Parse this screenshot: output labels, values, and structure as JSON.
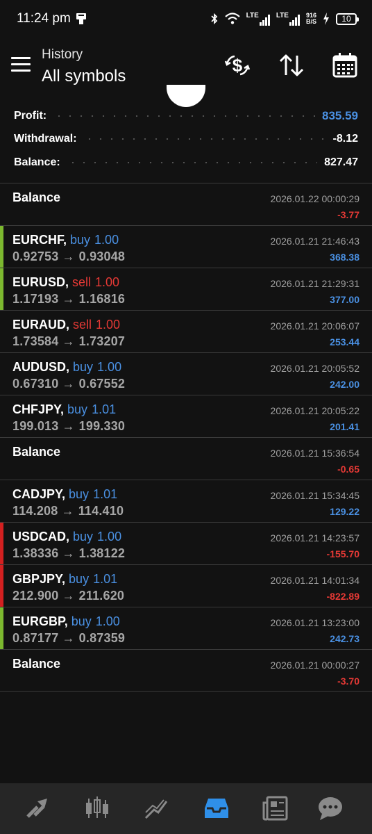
{
  "status": {
    "time": "11:24 pm",
    "lte1": "LTE",
    "lte2": "LTE",
    "speed_top": "916",
    "speed_bottom": "B/S",
    "battery": "10"
  },
  "header": {
    "title": "History",
    "subtitle": "All symbols",
    "icons": [
      "currency-exchange-icon",
      "sort-icon",
      "calendar-icon"
    ]
  },
  "summary": {
    "profit_label": "Profit:",
    "profit_value": "835.59",
    "withdrawal_label": "Withdrawal:",
    "withdrawal_value": "-8.12",
    "balance_label": "Balance:",
    "balance_value": "827.47"
  },
  "history": [
    {
      "symbol": "Balance",
      "side": "",
      "volume": "",
      "open": "",
      "close": "",
      "time": "2026.01.22 00:00:29",
      "profit": "-3.77",
      "kind": "balance",
      "pnl": "neg"
    },
    {
      "symbol": "EURCHF,",
      "side": "buy",
      "volume": "1.00",
      "open": "0.92753",
      "close": "0.93048",
      "time": "2026.01.21 21:46:43",
      "profit": "368.38",
      "kind": "win",
      "pnl": "pos"
    },
    {
      "symbol": "EURUSD,",
      "side": "sell",
      "volume": "1.00",
      "open": "1.17193",
      "close": "1.16816",
      "time": "2026.01.21 21:29:31",
      "profit": "377.00",
      "kind": "win",
      "pnl": "pos"
    },
    {
      "symbol": "EURAUD,",
      "side": "sell",
      "volume": "1.00",
      "open": "1.73584",
      "close": "1.73207",
      "time": "2026.01.21 20:06:07",
      "profit": "253.44",
      "kind": "none",
      "pnl": "pos"
    },
    {
      "symbol": "AUDUSD,",
      "side": "buy",
      "volume": "1.00",
      "open": "0.67310",
      "close": "0.67552",
      "time": "2026.01.21 20:05:52",
      "profit": "242.00",
      "kind": "none",
      "pnl": "pos"
    },
    {
      "symbol": "CHFJPY,",
      "side": "buy",
      "volume": "1.01",
      "open": "199.013",
      "close": "199.330",
      "time": "2026.01.21 20:05:22",
      "profit": "201.41",
      "kind": "none",
      "pnl": "pos"
    },
    {
      "symbol": "Balance",
      "side": "",
      "volume": "",
      "open": "",
      "close": "",
      "time": "2026.01.21 15:36:54",
      "profit": "-0.65",
      "kind": "balance",
      "pnl": "neg"
    },
    {
      "symbol": "CADJPY,",
      "side": "buy",
      "volume": "1.01",
      "open": "114.208",
      "close": "114.410",
      "time": "2026.01.21 15:34:45",
      "profit": "129.22",
      "kind": "none",
      "pnl": "pos"
    },
    {
      "symbol": "USDCAD,",
      "side": "buy",
      "volume": "1.00",
      "open": "1.38336",
      "close": "1.38122",
      "time": "2026.01.21 14:23:57",
      "profit": "-155.70",
      "kind": "loss",
      "pnl": "neg"
    },
    {
      "symbol": "GBPJPY,",
      "side": "buy",
      "volume": "1.01",
      "open": "212.900",
      "close": "211.620",
      "time": "2026.01.21 14:01:34",
      "profit": "-822.89",
      "kind": "loss",
      "pnl": "neg"
    },
    {
      "symbol": "EURGBP,",
      "side": "buy",
      "volume": "1.00",
      "open": "0.87177",
      "close": "0.87359",
      "time": "2026.01.21 13:23:00",
      "profit": "242.73",
      "kind": "win",
      "pnl": "pos"
    },
    {
      "symbol": "Balance",
      "side": "",
      "volume": "",
      "open": "",
      "close": "",
      "time": "2026.01.21 00:00:27",
      "profit": "-3.70",
      "kind": "balance",
      "pnl": "neg"
    }
  ],
  "nav": {
    "items": [
      "trade-icon",
      "chart-icon",
      "trade-history-icon",
      "history-inbox-icon",
      "news-icon",
      "chat-icon"
    ],
    "active": "history-inbox-icon"
  },
  "colors": {
    "accent": "#4a90e2",
    "loss": "#e53935",
    "win_marker": "#7cb82f",
    "loss_marker": "#d32020"
  }
}
